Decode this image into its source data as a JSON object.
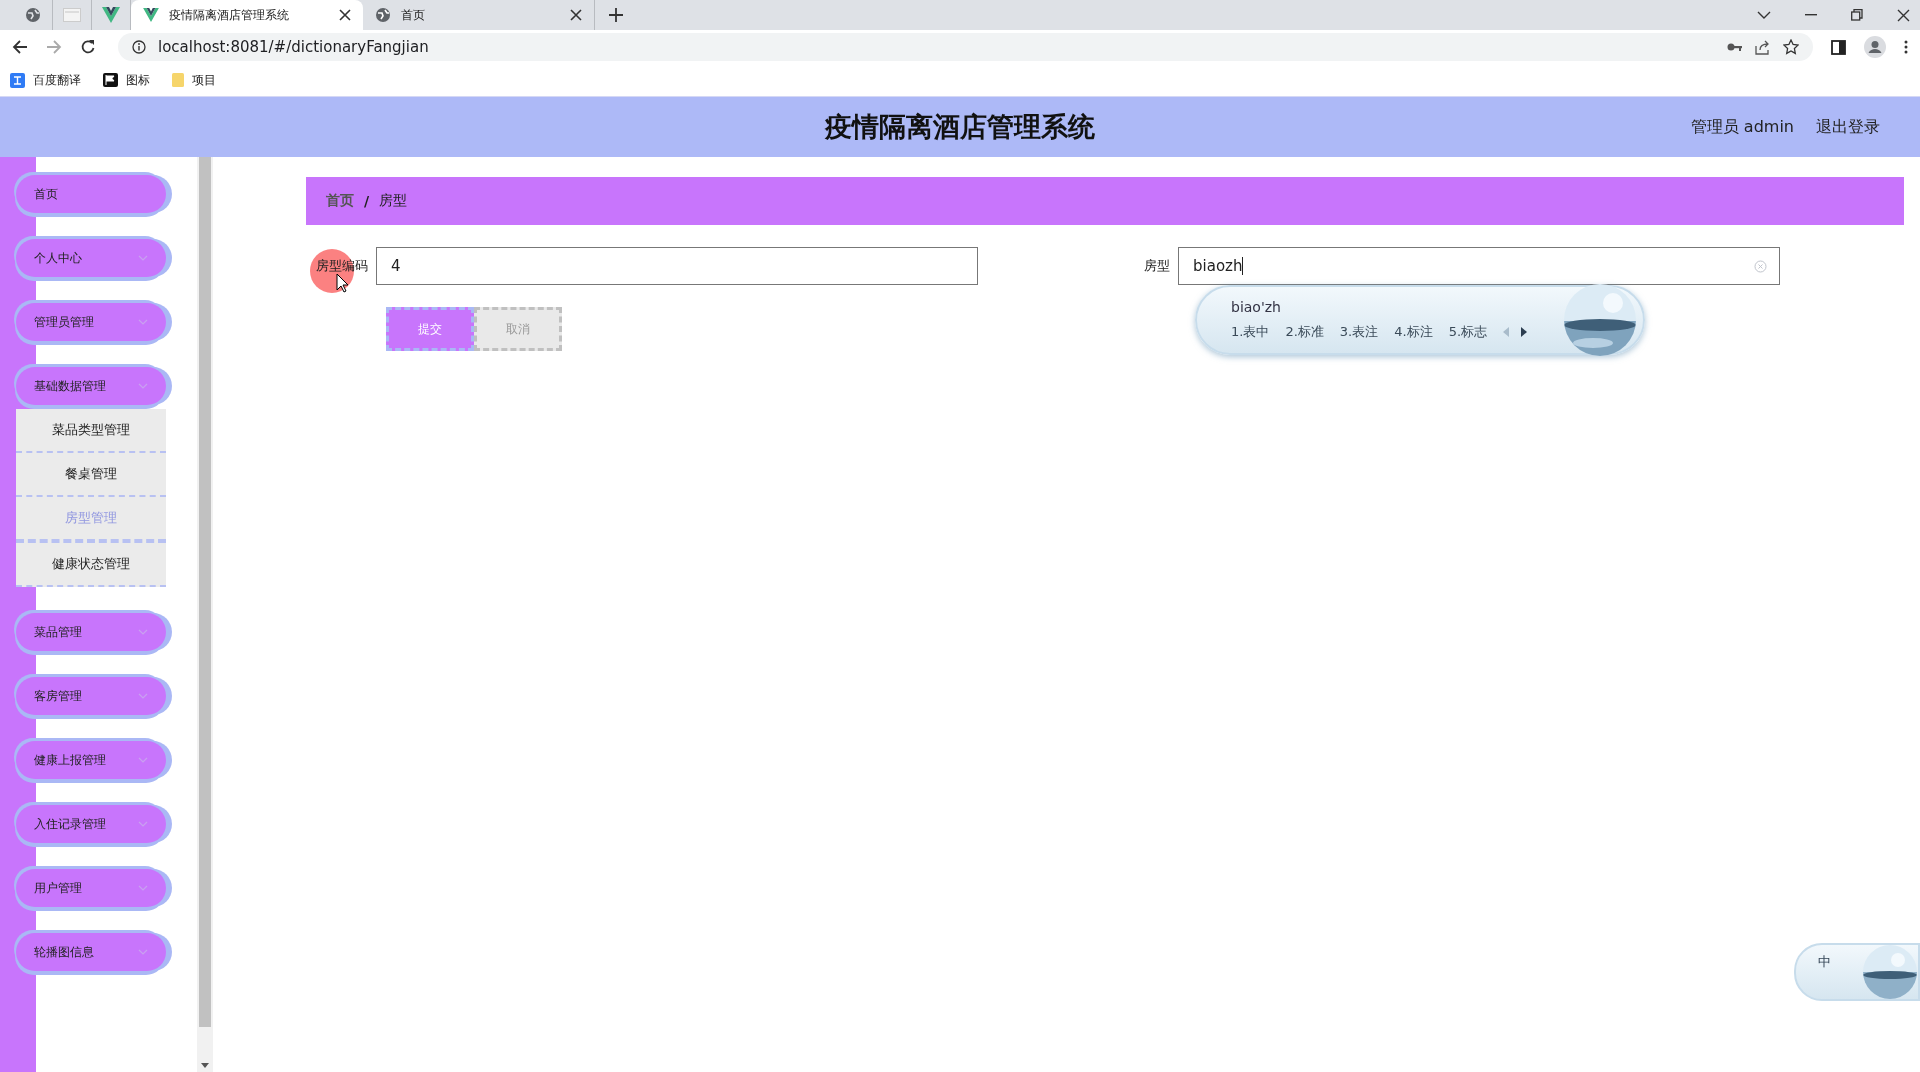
{
  "browser": {
    "pinned_tabs": [
      {
        "kind": "globe"
      },
      {
        "kind": "page"
      },
      {
        "kind": "vue"
      }
    ],
    "tabs": [
      {
        "label": "疫情隔离酒店管理系统",
        "kind": "vue",
        "selected": true
      },
      {
        "label": "首页",
        "kind": "globe",
        "selected": false
      }
    ],
    "url": "localhost:8081/#/dictionaryFangjian",
    "bookmarks": [
      {
        "label": "百度翻译",
        "kind": "translate"
      },
      {
        "label": "图标",
        "kind": "flag"
      },
      {
        "label": "项目",
        "kind": "folder"
      }
    ]
  },
  "header": {
    "title": "疫情隔离酒店管理系统",
    "user": "管理员 admin",
    "logout": "退出登录"
  },
  "sidebar": {
    "items": [
      {
        "label": "首页",
        "kind": "link"
      },
      {
        "label": "个人中心",
        "kind": "group"
      },
      {
        "label": "管理员管理",
        "kind": "group"
      },
      {
        "label": "基础数据管理",
        "kind": "group",
        "children": [
          {
            "label": "菜品类型管理",
            "selected": false
          },
          {
            "label": "餐桌管理",
            "selected": false
          },
          {
            "label": "房型管理",
            "selected": true
          },
          {
            "label": "健康状态管理",
            "selected": false
          }
        ]
      },
      {
        "label": "菜品管理",
        "kind": "group"
      },
      {
        "label": "客房管理",
        "kind": "group"
      },
      {
        "label": "健康上报管理",
        "kind": "group"
      },
      {
        "label": "入住记录管理",
        "kind": "group"
      },
      {
        "label": "用户管理",
        "kind": "group"
      },
      {
        "label": "轮播图信息",
        "kind": "group"
      }
    ]
  },
  "breadcrumb": {
    "items": [
      "首页",
      "房型"
    ],
    "separator": "/"
  },
  "form": {
    "fields": [
      {
        "label": "房型编码",
        "value": "4"
      },
      {
        "label": "房型",
        "value": "biaozh"
      }
    ],
    "buttons": [
      {
        "label": "提交",
        "kind": "primary"
      },
      {
        "label": "取消",
        "kind": "secondary"
      }
    ]
  },
  "ime": {
    "composition": "biao'zh",
    "candidates": [
      "1.表中",
      "2.标准",
      "3.表注",
      "4.标注",
      "5.标志"
    ],
    "mode": "中"
  }
}
